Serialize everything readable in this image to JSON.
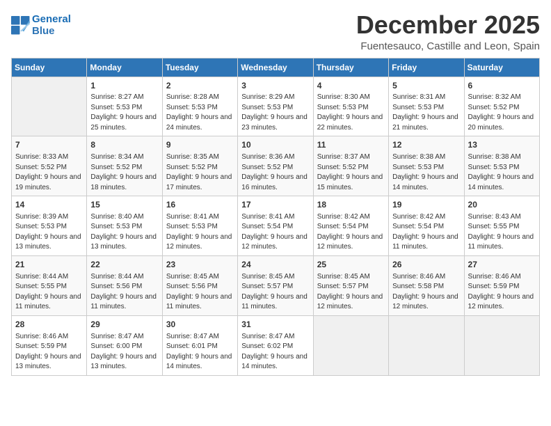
{
  "header": {
    "logo_line1": "General",
    "logo_line2": "Blue",
    "month_title": "December 2025",
    "location": "Fuentesauco, Castille and Leon, Spain"
  },
  "days_of_week": [
    "Sunday",
    "Monday",
    "Tuesday",
    "Wednesday",
    "Thursday",
    "Friday",
    "Saturday"
  ],
  "weeks": [
    [
      {
        "day": null
      },
      {
        "day": "1",
        "sunrise": "8:27 AM",
        "sunset": "5:53 PM",
        "daylight": "9 hours and 25 minutes."
      },
      {
        "day": "2",
        "sunrise": "8:28 AM",
        "sunset": "5:53 PM",
        "daylight": "9 hours and 24 minutes."
      },
      {
        "day": "3",
        "sunrise": "8:29 AM",
        "sunset": "5:53 PM",
        "daylight": "9 hours and 23 minutes."
      },
      {
        "day": "4",
        "sunrise": "8:30 AM",
        "sunset": "5:53 PM",
        "daylight": "9 hours and 22 minutes."
      },
      {
        "day": "5",
        "sunrise": "8:31 AM",
        "sunset": "5:53 PM",
        "daylight": "9 hours and 21 minutes."
      },
      {
        "day": "6",
        "sunrise": "8:32 AM",
        "sunset": "5:52 PM",
        "daylight": "9 hours and 20 minutes."
      }
    ],
    [
      {
        "day": "7",
        "sunrise": "8:33 AM",
        "sunset": "5:52 PM",
        "daylight": "9 hours and 19 minutes."
      },
      {
        "day": "8",
        "sunrise": "8:34 AM",
        "sunset": "5:52 PM",
        "daylight": "9 hours and 18 minutes."
      },
      {
        "day": "9",
        "sunrise": "8:35 AM",
        "sunset": "5:52 PM",
        "daylight": "9 hours and 17 minutes."
      },
      {
        "day": "10",
        "sunrise": "8:36 AM",
        "sunset": "5:52 PM",
        "daylight": "9 hours and 16 minutes."
      },
      {
        "day": "11",
        "sunrise": "8:37 AM",
        "sunset": "5:52 PM",
        "daylight": "9 hours and 15 minutes."
      },
      {
        "day": "12",
        "sunrise": "8:38 AM",
        "sunset": "5:53 PM",
        "daylight": "9 hours and 14 minutes."
      },
      {
        "day": "13",
        "sunrise": "8:38 AM",
        "sunset": "5:53 PM",
        "daylight": "9 hours and 14 minutes."
      }
    ],
    [
      {
        "day": "14",
        "sunrise": "8:39 AM",
        "sunset": "5:53 PM",
        "daylight": "9 hours and 13 minutes."
      },
      {
        "day": "15",
        "sunrise": "8:40 AM",
        "sunset": "5:53 PM",
        "daylight": "9 hours and 13 minutes."
      },
      {
        "day": "16",
        "sunrise": "8:41 AM",
        "sunset": "5:53 PM",
        "daylight": "9 hours and 12 minutes."
      },
      {
        "day": "17",
        "sunrise": "8:41 AM",
        "sunset": "5:54 PM",
        "daylight": "9 hours and 12 minutes."
      },
      {
        "day": "18",
        "sunrise": "8:42 AM",
        "sunset": "5:54 PM",
        "daylight": "9 hours and 12 minutes."
      },
      {
        "day": "19",
        "sunrise": "8:42 AM",
        "sunset": "5:54 PM",
        "daylight": "9 hours and 11 minutes."
      },
      {
        "day": "20",
        "sunrise": "8:43 AM",
        "sunset": "5:55 PM",
        "daylight": "9 hours and 11 minutes."
      }
    ],
    [
      {
        "day": "21",
        "sunrise": "8:44 AM",
        "sunset": "5:55 PM",
        "daylight": "9 hours and 11 minutes."
      },
      {
        "day": "22",
        "sunrise": "8:44 AM",
        "sunset": "5:56 PM",
        "daylight": "9 hours and 11 minutes."
      },
      {
        "day": "23",
        "sunrise": "8:45 AM",
        "sunset": "5:56 PM",
        "daylight": "9 hours and 11 minutes."
      },
      {
        "day": "24",
        "sunrise": "8:45 AM",
        "sunset": "5:57 PM",
        "daylight": "9 hours and 11 minutes."
      },
      {
        "day": "25",
        "sunrise": "8:45 AM",
        "sunset": "5:57 PM",
        "daylight": "9 hours and 12 minutes."
      },
      {
        "day": "26",
        "sunrise": "8:46 AM",
        "sunset": "5:58 PM",
        "daylight": "9 hours and 12 minutes."
      },
      {
        "day": "27",
        "sunrise": "8:46 AM",
        "sunset": "5:59 PM",
        "daylight": "9 hours and 12 minutes."
      }
    ],
    [
      {
        "day": "28",
        "sunrise": "8:46 AM",
        "sunset": "5:59 PM",
        "daylight": "9 hours and 13 minutes."
      },
      {
        "day": "29",
        "sunrise": "8:47 AM",
        "sunset": "6:00 PM",
        "daylight": "9 hours and 13 minutes."
      },
      {
        "day": "30",
        "sunrise": "8:47 AM",
        "sunset": "6:01 PM",
        "daylight": "9 hours and 14 minutes."
      },
      {
        "day": "31",
        "sunrise": "8:47 AM",
        "sunset": "6:02 PM",
        "daylight": "9 hours and 14 minutes."
      },
      {
        "day": null
      },
      {
        "day": null
      },
      {
        "day": null
      }
    ]
  ],
  "labels": {
    "sunrise_prefix": "Sunrise: ",
    "sunset_prefix": "Sunset: ",
    "daylight_prefix": "Daylight: "
  }
}
